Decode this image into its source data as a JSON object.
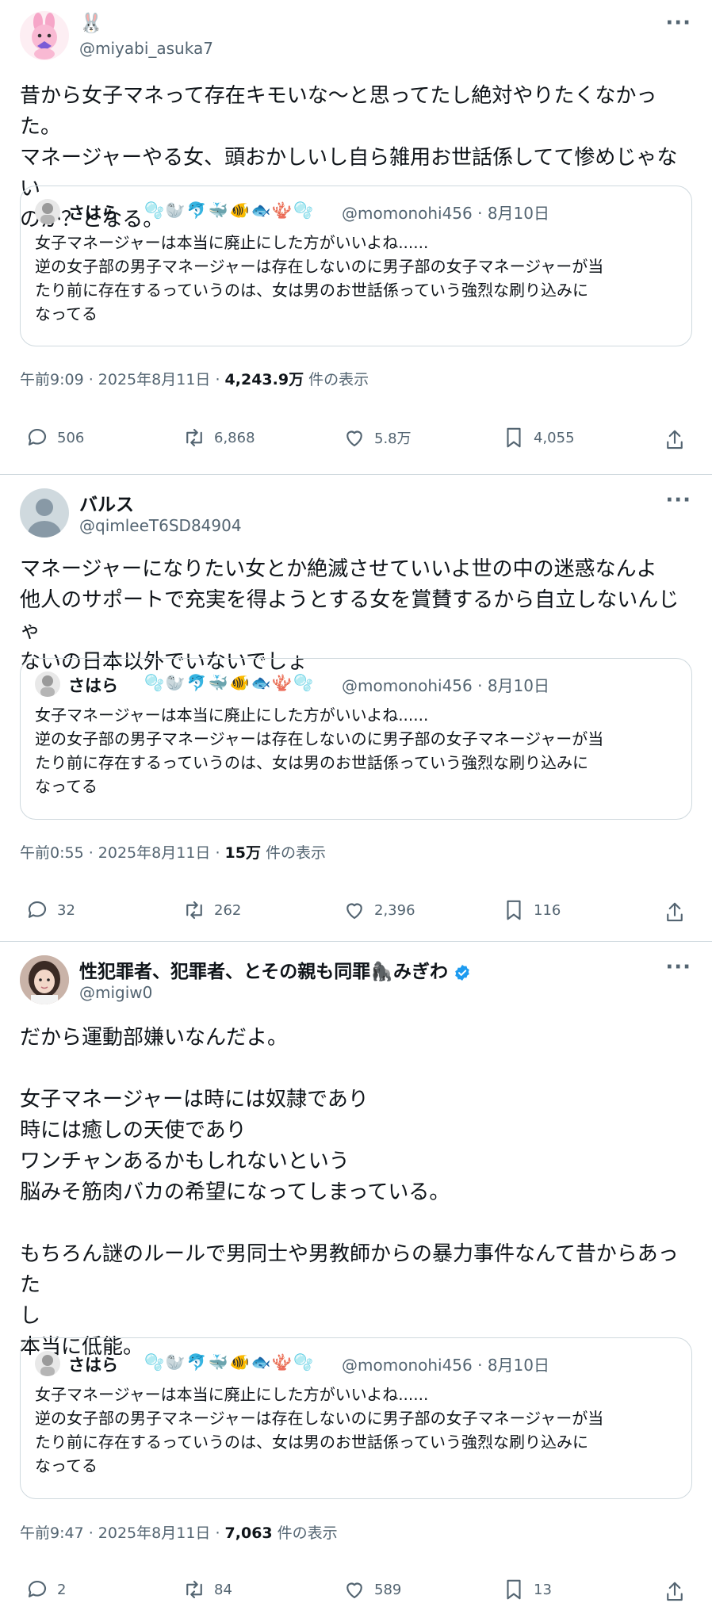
{
  "tweets": [
    {
      "name": "🐰",
      "handle": "@miyabi_asuka7",
      "text": "昔から女子マネって存在キモいな〜と思ってたし絶対やりたくなかった。\nマネージャーやる女、頭おかしいし自ら雑用お世話係してて惨めじゃない\nのか？となる。",
      "quote": {
        "name": "さはら",
        "emoji": "🫧🦭🐬🐳🐠🐟🪸🫧",
        "handle": "@momonohi456 · 8月10日",
        "text": "女子マネージャーは本当に廃止にした方がいいよね......\n逆の女子部の男子マネージャーは存在しないのに男子部の女子マネージャーが当\nたり前に存在するっていうのは、女は男のお世話係っていう強烈な刷り込みに\nなってる"
      },
      "time": "午前9:09 · 2025年8月11日 · ",
      "views": "4,243.9万",
      "views_suffix": " 件の表示",
      "replies": "506",
      "retweets": "6,868",
      "likes": "5.8万",
      "bookmarks": "4,055"
    },
    {
      "name": "バルス",
      "handle": "@qimleeT6SD84904",
      "text": "マネージャーになりたい女とか絶滅させていいよ世の中の迷惑なんよ\n他人のサポートで充実を得ようとする女を賞賛するから自立しないんじゃ\nないの日本以外でいないでしょ",
      "quote": {
        "name": "さはら",
        "emoji": "🫧🦭🐬🐳🐠🐟🪸🫧",
        "handle": "@momonohi456 · 8月10日",
        "text": "女子マネージャーは本当に廃止にした方がいいよね......\n逆の女子部の男子マネージャーは存在しないのに男子部の女子マネージャーが当\nたり前に存在するっていうのは、女は男のお世話係っていう強烈な刷り込みに\nなってる"
      },
      "time": "午前0:55 · 2025年8月11日 · ",
      "views": "15万",
      "views_suffix": " 件の表示",
      "replies": "32",
      "retweets": "262",
      "likes": "2,396",
      "bookmarks": "116"
    },
    {
      "name": "性犯罪者、犯罪者、とその親も同罪🦍みぎわ",
      "handle": "@migiw0",
      "text": "だから運動部嫌いなんだよ。\n\n女子マネージャーは時には奴隷であり\n時には癒しの天使であり\nワンチャンあるかもしれないという\n脳みそ筋肉バカの希望になってしまっている。\n\nもちろん謎のルールで男同士や男教師からの暴力事件なんて昔からあった\nし\n本当に低能。",
      "quote": {
        "name": "さはら",
        "emoji": "🫧🦭🐬🐳🐠🐟🪸🫧",
        "handle": "@momonohi456 · 8月10日",
        "text": "女子マネージャーは本当に廃止にした方がいいよね......\n逆の女子部の男子マネージャーは存在しないのに男子部の女子マネージャーが当\nたり前に存在するっていうのは、女は男のお世話係っていう強烈な刷り込みに\nなってる"
      },
      "time": "午前9:47 · 2025年8月11日 · ",
      "views": "7,063",
      "views_suffix": " 件の表示",
      "replies": "2",
      "retweets": "84",
      "likes": "589",
      "bookmarks": "13"
    }
  ],
  "colors": {
    "text": "#0f1419",
    "secondary": "#536471",
    "border": "#cfd9de",
    "verified": "#1d9bf0"
  },
  "icons": [
    "reply-icon",
    "retweet-icon",
    "like-icon",
    "bookmark-icon",
    "share-icon",
    "more-icon",
    "verified-icon"
  ]
}
